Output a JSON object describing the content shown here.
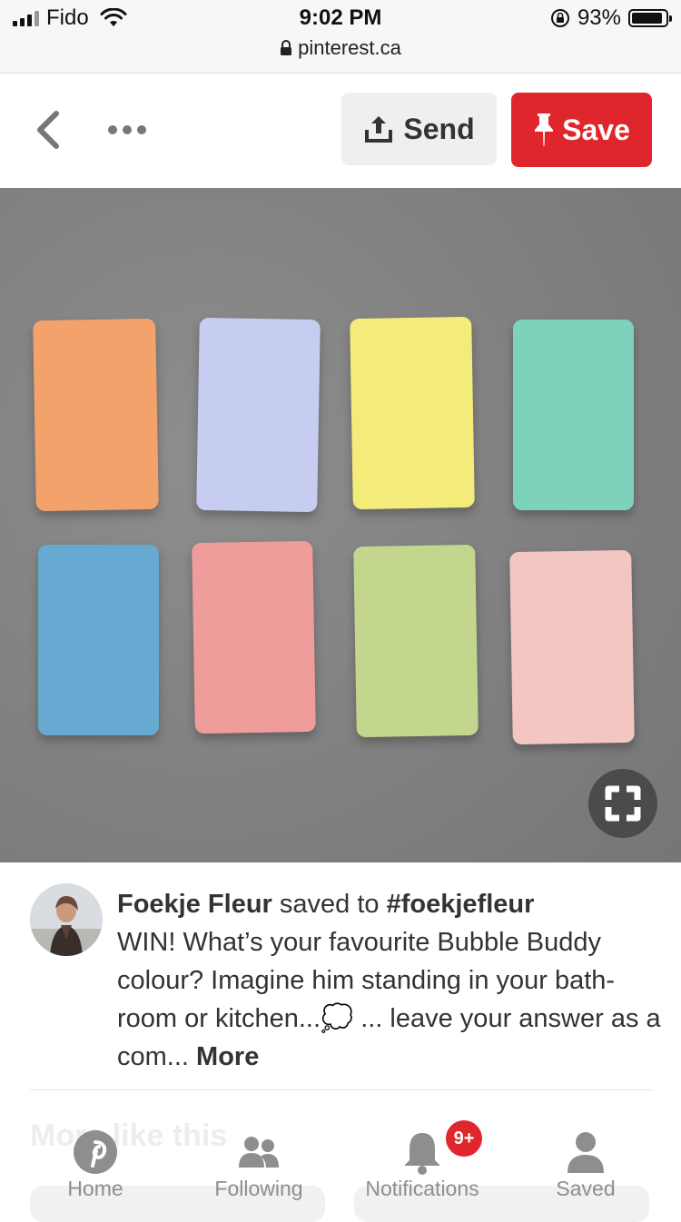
{
  "status_bar": {
    "carrier": "Fido",
    "time": "9:02 PM",
    "url": "pinterest.ca",
    "battery_percent": "93%",
    "battery_level": 0.93
  },
  "action_bar": {
    "back_icon": "chevron-left-icon",
    "more_icon": "more-dots-icon",
    "send_label": "Send",
    "save_label": "Save",
    "save_color": "#e0262d"
  },
  "pin_image": {
    "tile_colors": [
      "#f3a26c",
      "#c7cdf0",
      "#f4ec7a",
      "#7dd2bc",
      "#67a9d0",
      "#ee9d9b",
      "#c3d68e",
      "#f3c6c2"
    ]
  },
  "pin": {
    "user": "Foekje Fleur",
    "saved_to_text": "saved to",
    "board": "#foekjefleur",
    "description_1": "WIN! What’s your favourite Bubble Buddy colour? Imagine him standing in your bath-room or kitchen...",
    "emoji": "💭",
    "description_2": " ... leave your answer as a com...",
    "more_label": "More"
  },
  "more_like_this": "More like this",
  "tabs": [
    {
      "label": "Home",
      "icon": "pinterest-logo-icon"
    },
    {
      "label": "Following",
      "icon": "people-icon"
    },
    {
      "label": "Notifications",
      "icon": "bell-icon",
      "badge": "9+"
    },
    {
      "label": "Saved",
      "icon": "person-icon"
    }
  ]
}
